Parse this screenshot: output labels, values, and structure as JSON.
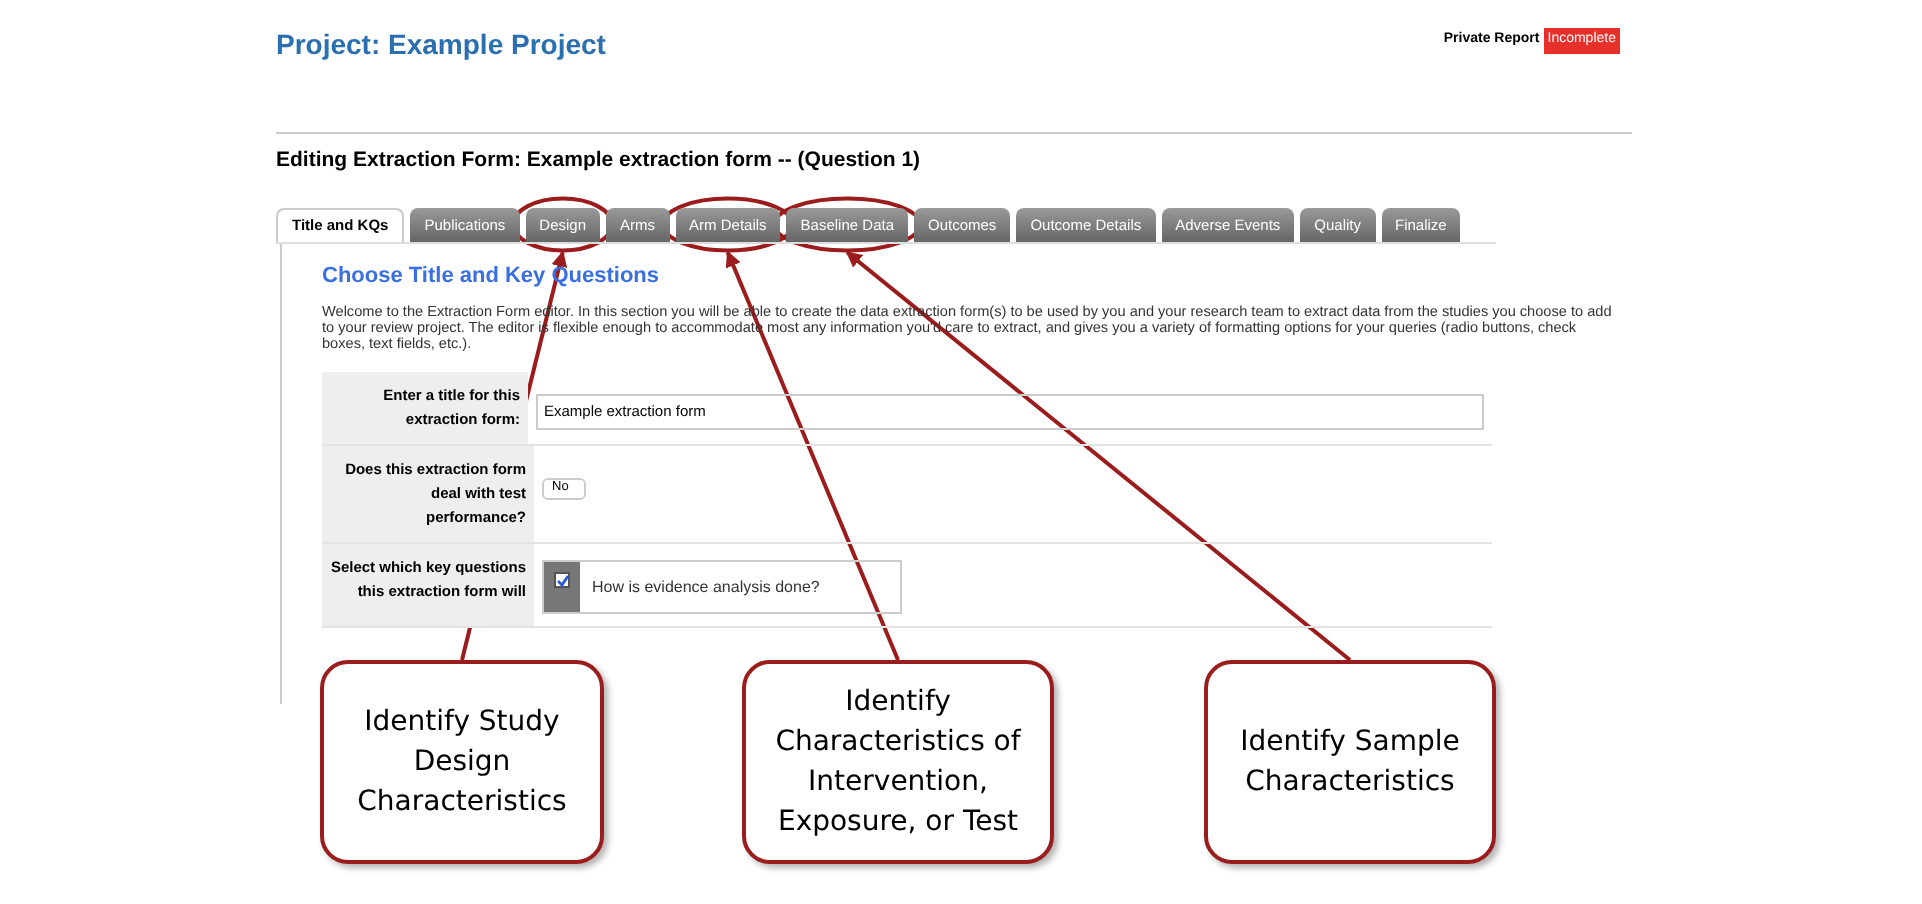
{
  "header": {
    "title": "Project: Example Project",
    "report_label": "Private Report",
    "status_badge": "Incomplete"
  },
  "form_heading": "Editing Extraction Form: Example extraction form -- (Question 1)",
  "tabs": [
    {
      "label": "Title and KQs",
      "selected": true
    },
    {
      "label": "Publications",
      "selected": false
    },
    {
      "label": "Design",
      "selected": false,
      "callout": "Identify Study Design Characteristics"
    },
    {
      "label": "Arms",
      "selected": false
    },
    {
      "label": "Arm Details",
      "selected": false,
      "callout": "Identify Characteristics of Intervention, Exposure, or Test"
    },
    {
      "label": "Baseline Data",
      "selected": false,
      "callout": "Identify Sample Characteristics"
    },
    {
      "label": "Outcomes",
      "selected": false
    },
    {
      "label": "Outcome Details",
      "selected": false
    },
    {
      "label": "Adverse Events",
      "selected": false
    },
    {
      "label": "Quality",
      "selected": false
    },
    {
      "label": "Finalize",
      "selected": false
    }
  ],
  "section": {
    "title": "Choose Title and Key Questions",
    "intro": "Welcome to the Extraction Form editor. In this section you will be able to create the data extraction form(s) to be used by you and your research team to extract data from the studies you choose to add to your review project. The editor is flexible enough to accommodate most any information you'd care to extract, and gives you a variety of formatting options for your queries (radio buttons, check boxes, text fields, etc.).",
    "fields": [
      {
        "kind": "text",
        "label": "Enter a title for this extraction form:",
        "value": "Example extraction form"
      },
      {
        "kind": "select",
        "label": "Does this extraction form deal with test performance?",
        "value": "No"
      },
      {
        "kind": "checklist",
        "label": "Select which key questions this extraction form will",
        "options": [
          {
            "label": "How is evidence analysis done?",
            "checked": true
          }
        ]
      }
    ]
  }
}
